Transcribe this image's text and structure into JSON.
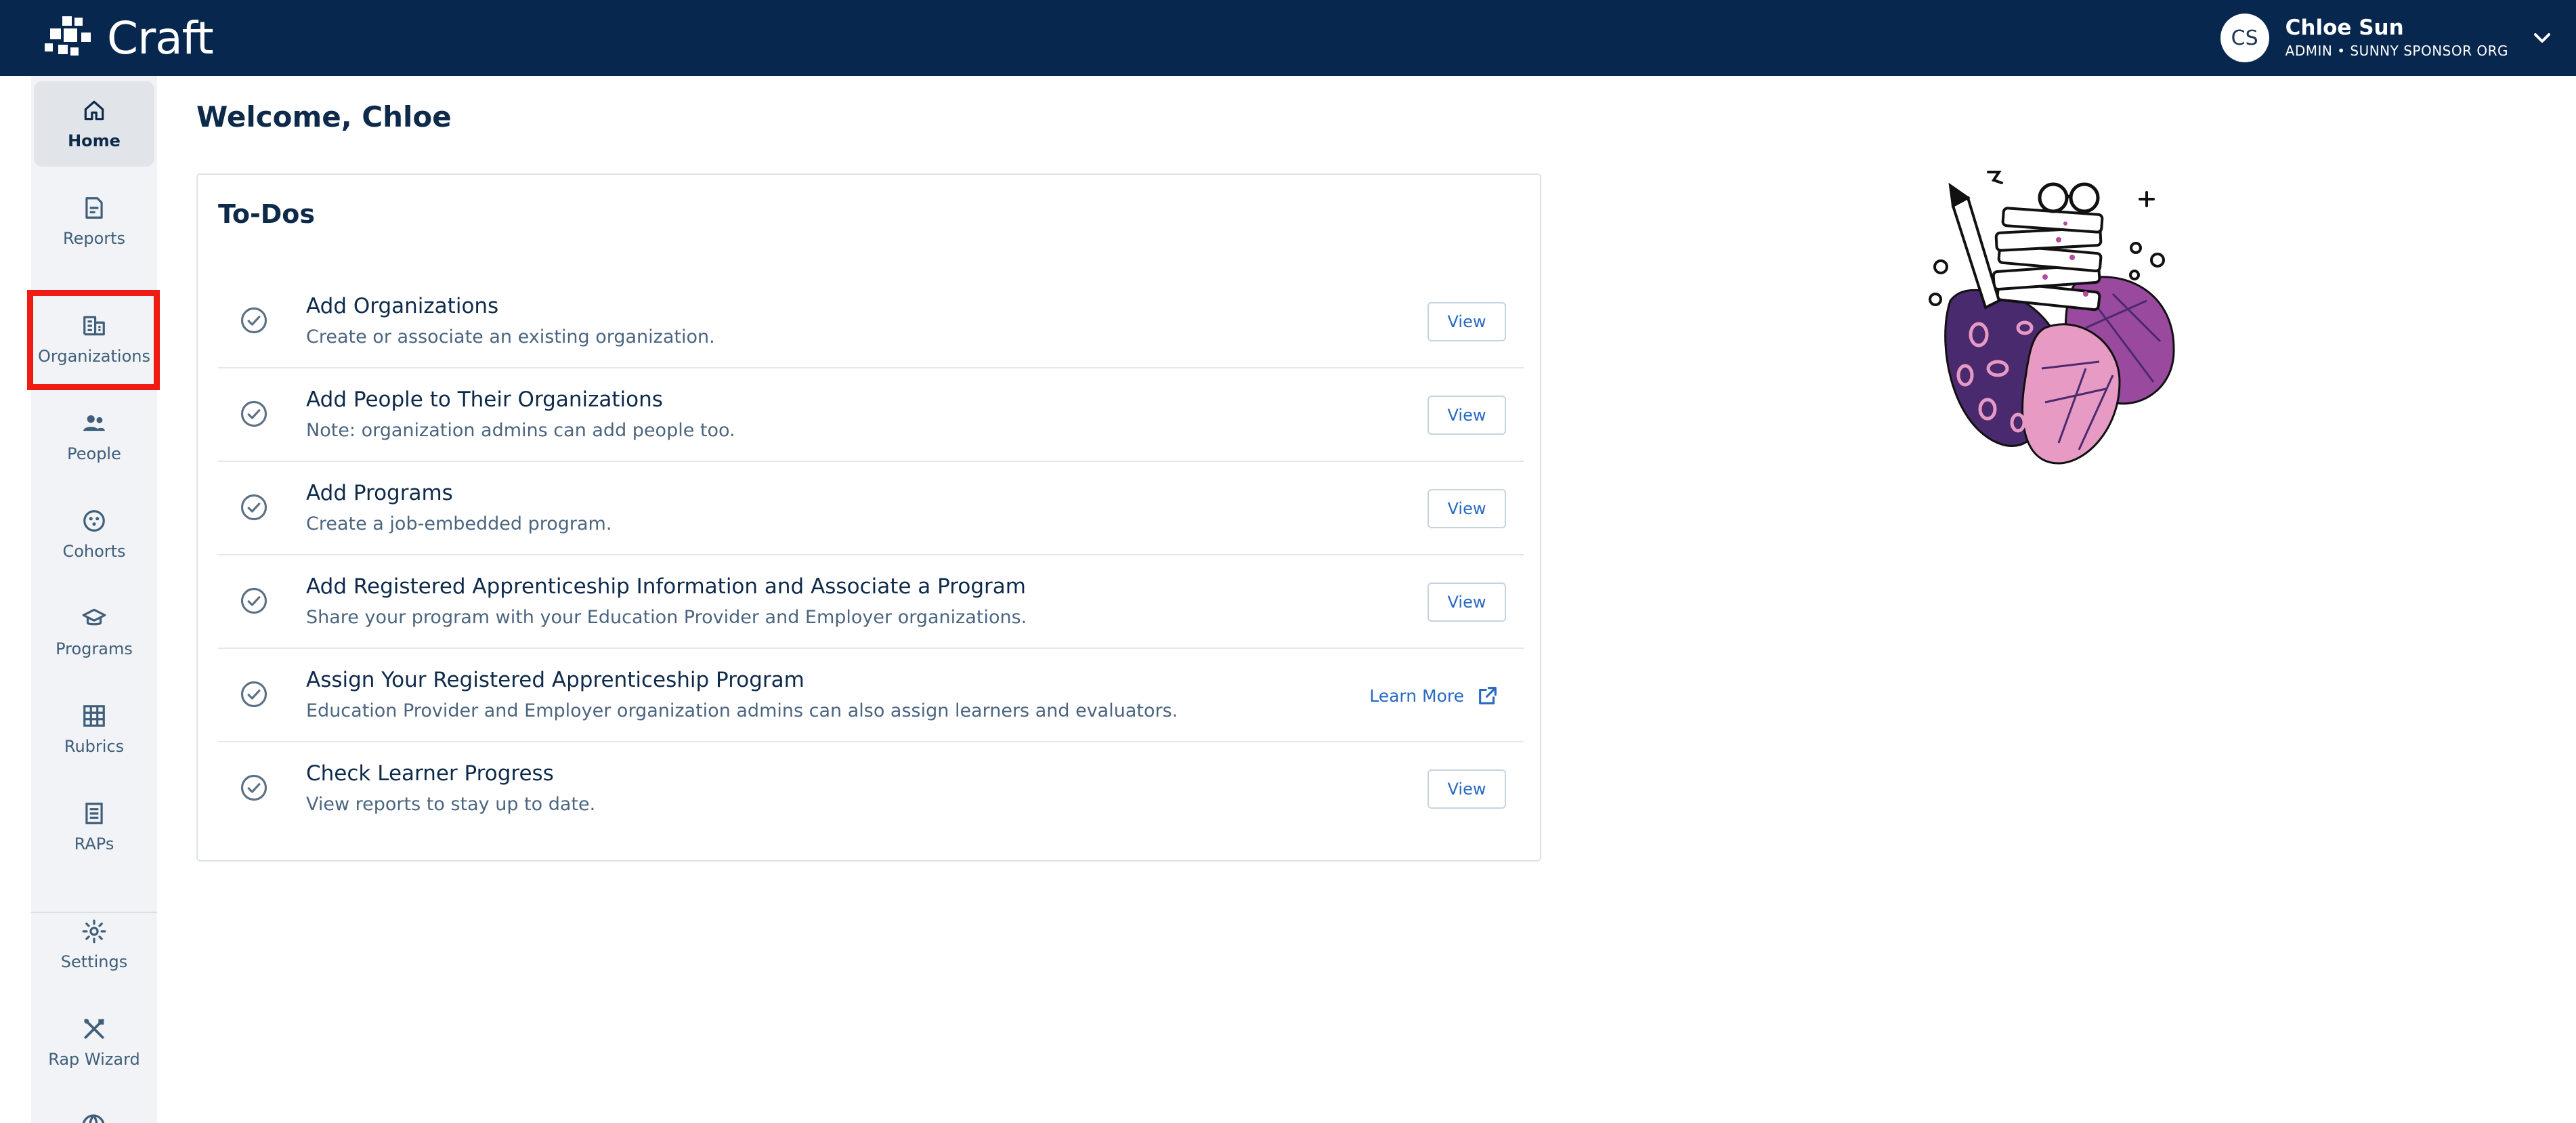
{
  "app": {
    "logo_text": "Craft"
  },
  "user": {
    "initials": "CS",
    "name": "Chloe Sun",
    "role": "ADMIN • SUNNY SPONSOR ORG"
  },
  "sidebar": {
    "items": [
      {
        "label": "Home",
        "icon": "home-icon",
        "active": true
      },
      {
        "label": "Reports",
        "icon": "reports-icon"
      },
      {
        "label": "Organizations",
        "icon": "organizations-icon",
        "highlighted": true
      },
      {
        "label": "People",
        "icon": "people-icon"
      },
      {
        "label": "Cohorts",
        "icon": "cohorts-icon"
      },
      {
        "label": "Programs",
        "icon": "programs-icon"
      },
      {
        "label": "Rubrics",
        "icon": "rubrics-icon"
      },
      {
        "label": "RAPs",
        "icon": "raps-icon"
      },
      {
        "label": "Settings",
        "icon": "gear-icon"
      },
      {
        "label": "Rap Wizard",
        "icon": "wizard-icon"
      }
    ]
  },
  "main": {
    "welcome": "Welcome, Chloe",
    "todos_title": "To-Dos",
    "todos": [
      {
        "title": "Add Organizations",
        "desc": "Create or associate an existing organization.",
        "action": "View"
      },
      {
        "title": "Add People to Their Organizations",
        "desc": "Note: organization admins can add people too.",
        "action": "View"
      },
      {
        "title": "Add Programs",
        "desc": "Create a job-embedded program.",
        "action": "View"
      },
      {
        "title": "Add Registered Apprenticeship Information and Associate a Program",
        "desc": "Share your program with your Education Provider and Employer organizations.",
        "action": "View"
      },
      {
        "title": "Assign Your Registered Apprenticeship Program",
        "desc": "Education Provider and Employer organization admins can also assign learners and evaluators.",
        "action": "Learn More"
      },
      {
        "title": "Check Learner Progress",
        "desc": "View reports to stay up to date.",
        "action": "View"
      }
    ]
  },
  "colors": {
    "header_bg": "#07274f",
    "accent": "#2769c4",
    "highlight": "#f01b12",
    "illustration_purple": "#4a2a6e",
    "illustration_pink": "#e79ac4"
  }
}
